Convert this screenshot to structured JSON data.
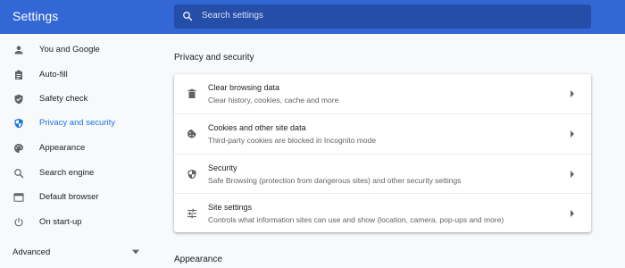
{
  "app": {
    "title": "Settings"
  },
  "search": {
    "placeholder": "Search settings",
    "icon": "search-icon"
  },
  "colors": {
    "header": "#3367d6",
    "active": "#1a73e8",
    "icon": "#5f6368"
  },
  "sidebar": {
    "items": [
      {
        "label": "You and Google",
        "icon": "person-icon",
        "active": false
      },
      {
        "label": "Auto-fill",
        "icon": "clipboard-icon",
        "active": false
      },
      {
        "label": "Safety check",
        "icon": "shield-check-icon",
        "active": false
      },
      {
        "label": "Privacy and security",
        "icon": "shield-icon",
        "active": true
      },
      {
        "label": "Appearance",
        "icon": "palette-icon",
        "active": false
      },
      {
        "label": "Search engine",
        "icon": "search-icon",
        "active": false
      },
      {
        "label": "Default browser",
        "icon": "browser-icon",
        "active": false
      },
      {
        "label": "On start-up",
        "icon": "power-icon",
        "active": false
      }
    ],
    "advanced": {
      "label": "Advanced",
      "icon": "chevron-down-icon"
    }
  },
  "main": {
    "privacy_section_title": "Privacy and security",
    "privacy_rows": [
      {
        "title": "Clear browsing data",
        "subtitle": "Clear history, cookies, cache and more",
        "icon": "trash-icon"
      },
      {
        "title": "Cookies and other site data",
        "subtitle": "Third-party cookies are blocked in Incognito mode",
        "icon": "cookie-icon"
      },
      {
        "title": "Security",
        "subtitle": "Safe Browsing (protection from dangerous sites) and other security settings",
        "icon": "shield-icon"
      },
      {
        "title": "Site settings",
        "subtitle": "Controls what information sites can use and show (location, camera, pop-ups and more)",
        "icon": "tune-icon"
      }
    ],
    "appearance_section_title": "Appearance"
  }
}
